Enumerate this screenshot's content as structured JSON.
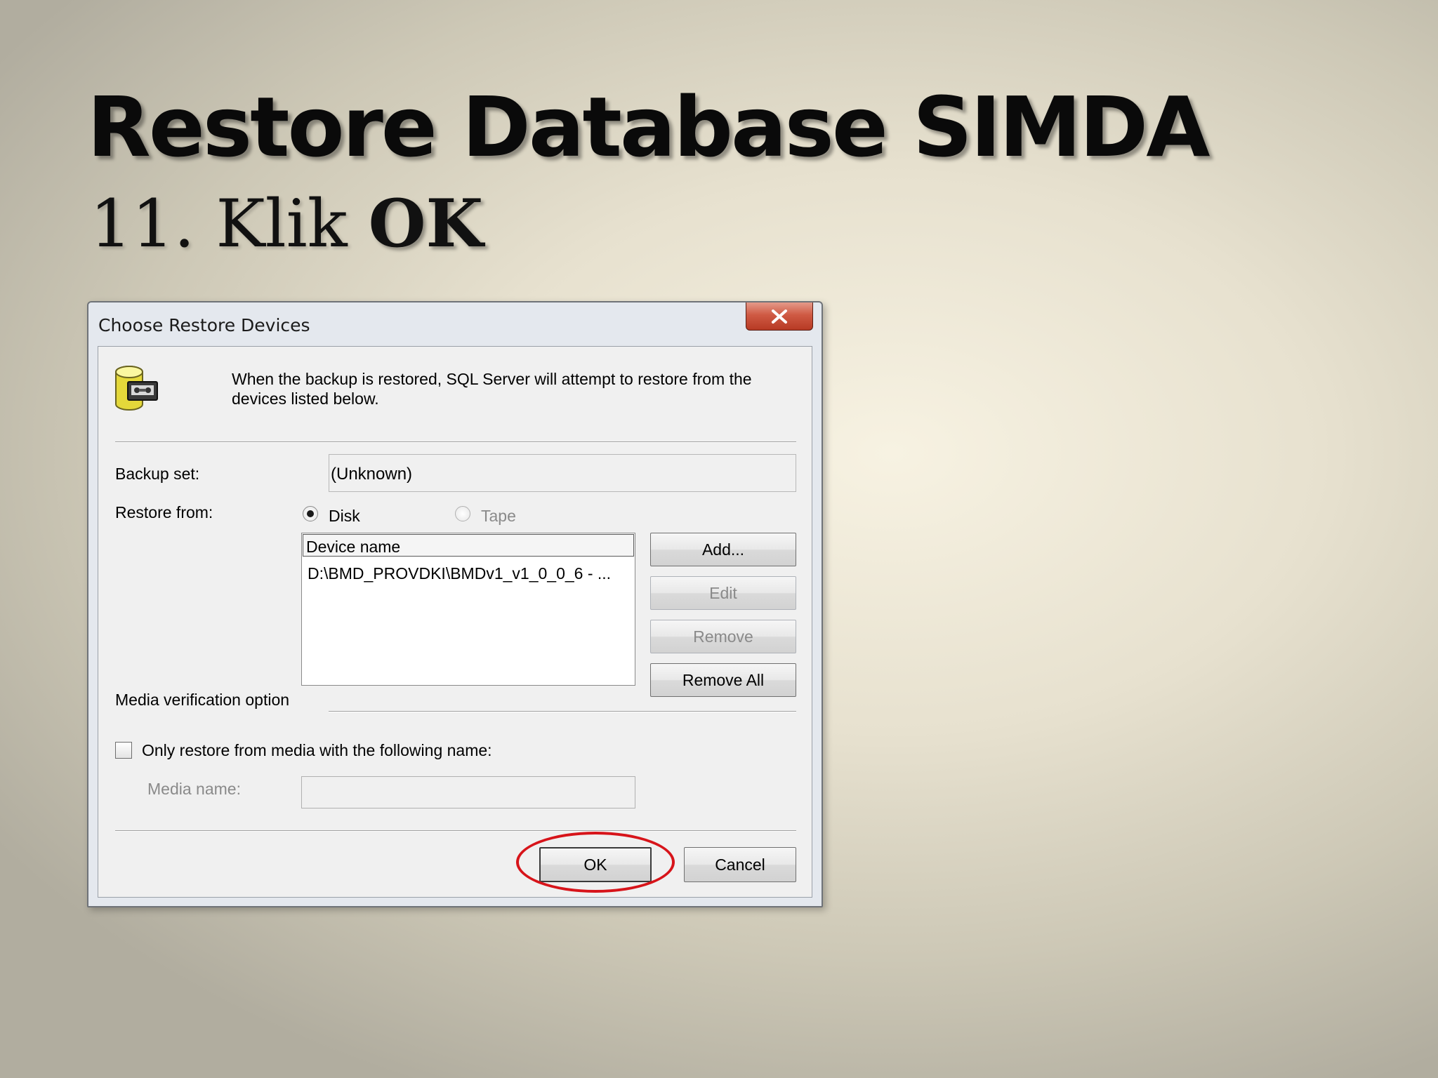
{
  "slide": {
    "title": "Restore Database SIMDA",
    "step_prefix": "11. Klik ",
    "step_action": "OK"
  },
  "dialog": {
    "title": "Choose Restore Devices",
    "close_icon": "close-icon",
    "info_icon": "database-tape-icon",
    "info_text": "When the backup is restored, SQL Server will attempt to restore from the devices listed below.",
    "backup_set_label": "Backup set:",
    "backup_set_value": "(Unknown)",
    "restore_from_label": "Restore from:",
    "restore_options": [
      {
        "label": "Disk",
        "selected": true,
        "enabled": true
      },
      {
        "label": "Tape",
        "selected": false,
        "enabled": false
      }
    ],
    "device_list": {
      "header": "Device name",
      "rows": [
        "D:\\BMD_PROVDKI\\BMDv1_v1_0_0_6 - ..."
      ]
    },
    "buttons": {
      "add": "Add...",
      "edit": "Edit",
      "remove": "Remove",
      "remove_all": "Remove All",
      "ok": "OK",
      "cancel": "Cancel"
    },
    "media_verification_label": "Media verification option",
    "only_restore_label": "Only restore from media with the following name:",
    "only_restore_checked": false,
    "media_name_label": "Media name:",
    "media_name_value": ""
  },
  "colors": {
    "highlight_circle": "#d7141a",
    "close_button": "#c9503a"
  }
}
